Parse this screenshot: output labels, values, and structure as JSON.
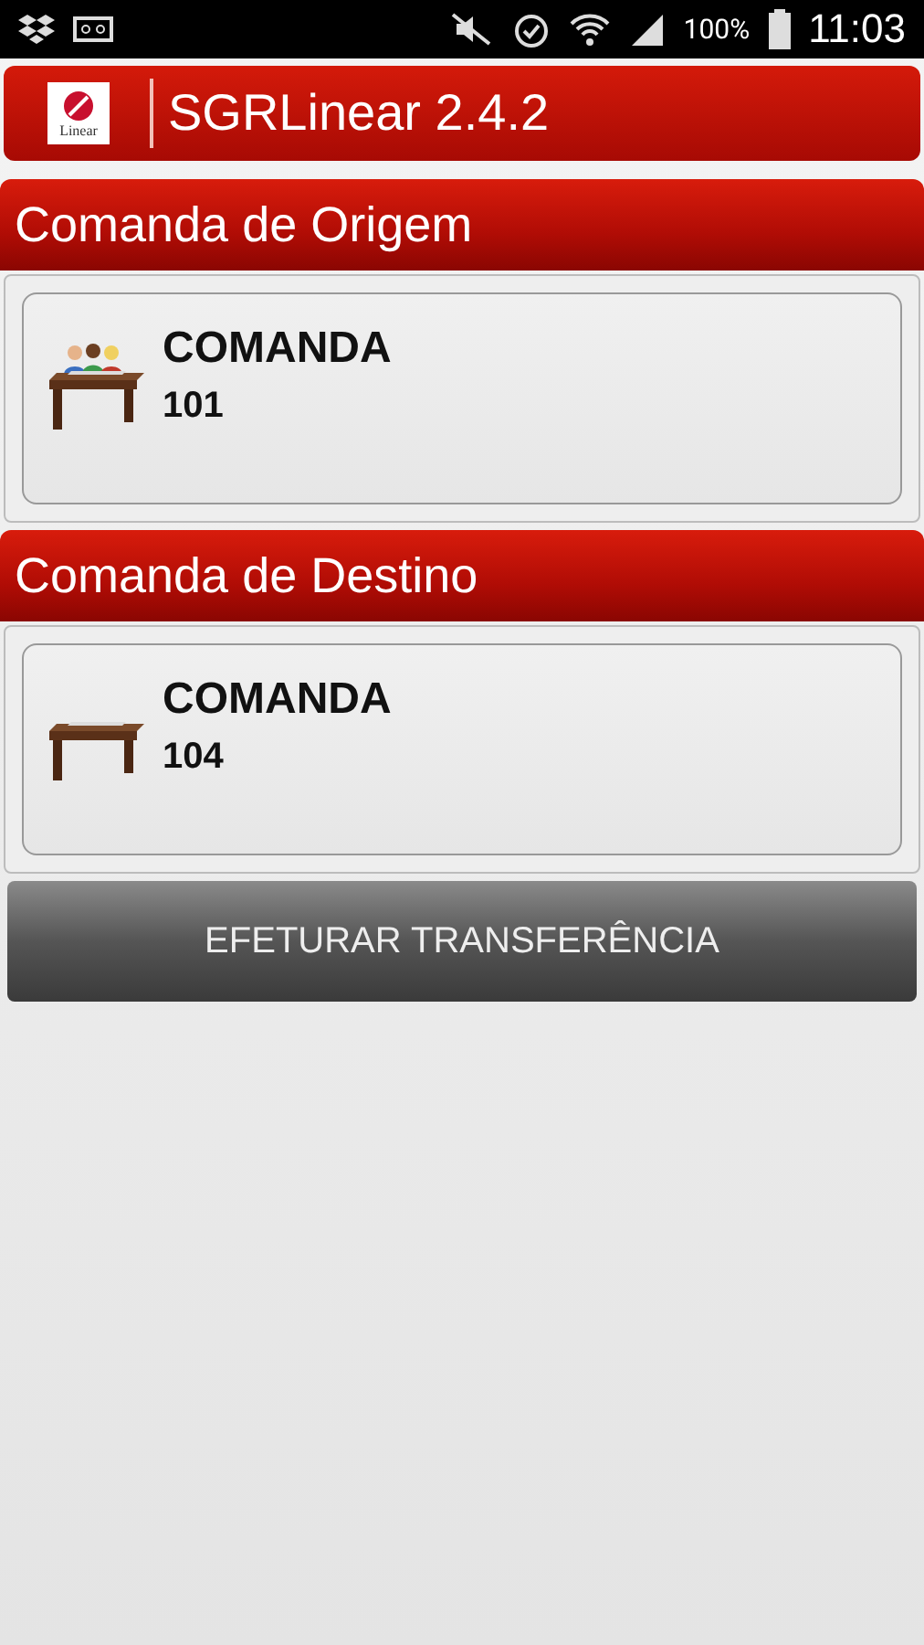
{
  "status_bar": {
    "battery": "100%",
    "time": "11:03"
  },
  "app_bar": {
    "logo_text": "Linear",
    "title": "SGRLinear 2.4.2"
  },
  "sections": [
    {
      "title": "Comanda de Origem",
      "item": {
        "kind": "occupied",
        "label": "COMANDA",
        "number": "101"
      }
    },
    {
      "title": "Comanda de Destino",
      "item": {
        "kind": "empty",
        "label": "COMANDA",
        "number": "104"
      }
    }
  ],
  "action_button": "EFETURAR TRANSFERÊNCIA"
}
